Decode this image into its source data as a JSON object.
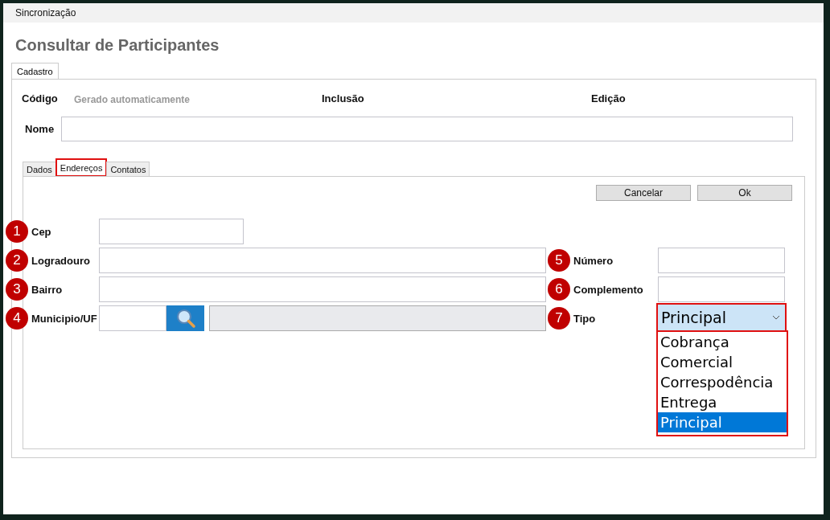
{
  "menu": {
    "items": [
      "Sincronização"
    ]
  },
  "title": "Consultar de Participantes",
  "outer_tabs": [
    {
      "label": "Cadastro",
      "selected": true
    }
  ],
  "header": {
    "codigo_label": "Código",
    "codigo_value": "Gerado automaticamente",
    "inclusao_label": "Inclusão",
    "edicao_label": "Edição",
    "nome_label": "Nome"
  },
  "inner_tabs": [
    {
      "label": "Dados",
      "selected": false,
      "highlighted": false
    },
    {
      "label": "Endereços",
      "selected": true,
      "highlighted": true
    },
    {
      "label": "Contatos",
      "selected": false,
      "highlighted": false
    }
  ],
  "buttons": [
    "Cancelar",
    "Ok"
  ],
  "address_form": {
    "left": [
      {
        "marker": "1",
        "label": "Cep",
        "kind": "short"
      },
      {
        "marker": "2",
        "label": "Logradouro",
        "kind": "text"
      },
      {
        "marker": "3",
        "label": "Bairro",
        "kind": "text"
      },
      {
        "marker": "4",
        "label": "Municipio/UF",
        "kind": "lookup"
      }
    ],
    "right": [
      {
        "marker": "5",
        "label": "Número",
        "kind": "text"
      },
      {
        "marker": "6",
        "label": "Complemento",
        "kind": "text"
      },
      {
        "marker": "7",
        "label": "Tipo",
        "kind": "select",
        "value": "Principal",
        "expanded": true,
        "highlighted": true,
        "options": [
          {
            "label": "Cobrança",
            "selected": false
          },
          {
            "label": "Comercial",
            "selected": false
          },
          {
            "label": "Correspodência",
            "selected": false
          },
          {
            "label": "Entrega",
            "selected": false
          },
          {
            "label": "Principal",
            "selected": true
          }
        ]
      }
    ]
  }
}
